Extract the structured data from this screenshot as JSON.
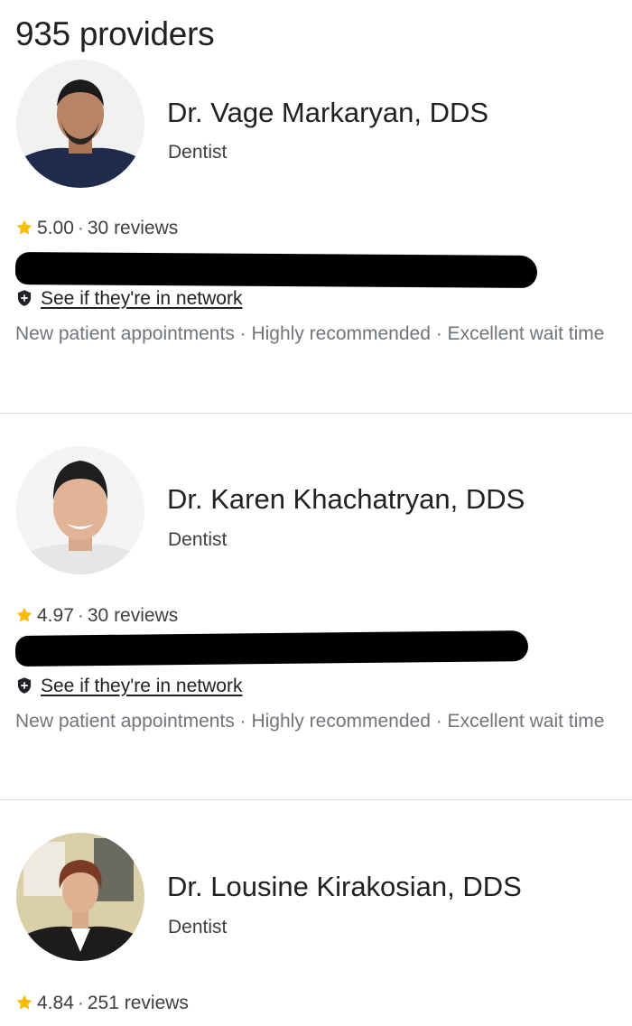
{
  "header": {
    "results_count": "935 providers"
  },
  "providers": [
    {
      "name": "Dr. Vage Markaryan, DDS",
      "specialty": "Dentist",
      "rating": "5.00",
      "reviews": "30 reviews",
      "network_link": "See if they're in network",
      "highlights": "New patient appointments · Highly recommended · Excellent wait time"
    },
    {
      "name": "Dr. Karen Khachatryan, DDS",
      "specialty": "Dentist",
      "rating": "4.97",
      "reviews": "30 reviews",
      "network_link": "See if they're in network",
      "highlights": "New patient appointments · Highly recommended · Excellent wait time"
    },
    {
      "name": "Dr. Lousine Kirakosian, DDS",
      "specialty": "Dentist",
      "rating": "4.84",
      "reviews": "251 reviews"
    }
  ],
  "separator": "·",
  "icons": {
    "star": "star-icon",
    "shield": "shield-plus-icon"
  },
  "colors": {
    "star": "#fbbc04",
    "text_primary": "#202124",
    "text_secondary": "#70757a",
    "divider": "#dadce0"
  }
}
